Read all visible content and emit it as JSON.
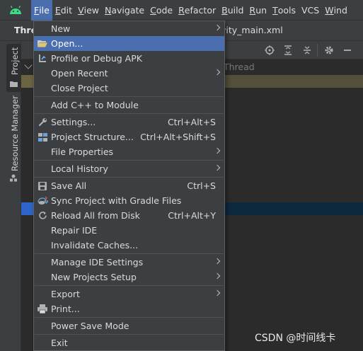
{
  "menubar": {
    "items": [
      {
        "label": "File",
        "mn": "F",
        "rest": "ile"
      },
      {
        "label": "Edit",
        "mn": "E",
        "rest": "dit"
      },
      {
        "label": "View",
        "mn": "V",
        "rest": "iew"
      },
      {
        "label": "Navigate",
        "mn": "N",
        "rest": "avigate"
      },
      {
        "label": "Code",
        "mn": "C",
        "rest": "ode"
      },
      {
        "label": "Refactor",
        "mn": "R",
        "rest": "efactor"
      },
      {
        "label": "Build",
        "mn": "B",
        "rest": "uild"
      },
      {
        "label": "Run",
        "mn": "R",
        "rest": "un"
      },
      {
        "label": "Tools",
        "mn": "T",
        "rest": "ools"
      },
      {
        "label": "VCS",
        "mn": "",
        "rest": "VCS"
      },
      {
        "label": "Wind",
        "mn": "W",
        "rest": "ind"
      }
    ]
  },
  "title_row": {
    "project_title": "Thre",
    "editor_tab": "vity_main.xml"
  },
  "tool_window": {
    "project_tab": "Project",
    "resource_manager_tab": "Resource Manager"
  },
  "editor": {
    "thread_text": "Thread"
  },
  "file_menu": {
    "items": [
      {
        "label": "New",
        "shortcut": "",
        "submenu": true,
        "icon": ""
      },
      {
        "label": "Open...",
        "shortcut": "",
        "submenu": false,
        "icon": "folder-open-icon",
        "selected": true
      },
      {
        "label": "Profile or Debug APK",
        "shortcut": "",
        "submenu": false,
        "icon": "profile-apk-icon"
      },
      {
        "label": "Open Recent",
        "shortcut": "",
        "submenu": true,
        "icon": ""
      },
      {
        "label": "Close Project",
        "shortcut": "",
        "submenu": false,
        "icon": ""
      },
      {
        "label": "Add C++ to Module",
        "shortcut": "",
        "submenu": false,
        "icon": ""
      },
      {
        "label": "Settings...",
        "shortcut": "Ctrl+Alt+S",
        "submenu": false,
        "icon": "wrench-icon"
      },
      {
        "label": "Project Structure...",
        "shortcut": "Ctrl+Alt+Shift+S",
        "submenu": false,
        "icon": "project-structure-icon"
      },
      {
        "label": "File Properties",
        "shortcut": "",
        "submenu": true,
        "icon": ""
      },
      {
        "label": "Local History",
        "shortcut": "",
        "submenu": true,
        "icon": ""
      },
      {
        "label": "Save All",
        "shortcut": "Ctrl+S",
        "submenu": false,
        "icon": "save-icon"
      },
      {
        "label": "Sync Project with Gradle Files",
        "shortcut": "",
        "submenu": false,
        "icon": "gradle-sync-icon"
      },
      {
        "label": "Reload All from Disk",
        "shortcut": "Ctrl+Alt+Y",
        "submenu": false,
        "icon": "reload-icon"
      },
      {
        "label": "Repair IDE",
        "shortcut": "",
        "submenu": false,
        "icon": ""
      },
      {
        "label": "Invalidate Caches...",
        "shortcut": "",
        "submenu": false,
        "icon": ""
      },
      {
        "label": "Manage IDE Settings",
        "shortcut": "",
        "submenu": true,
        "icon": ""
      },
      {
        "label": "New Projects Setup",
        "shortcut": "",
        "submenu": true,
        "icon": ""
      },
      {
        "label": "Export",
        "shortcut": "",
        "submenu": true,
        "icon": ""
      },
      {
        "label": "Print...",
        "shortcut": "",
        "submenu": false,
        "icon": "print-icon"
      },
      {
        "label": "Power Save Mode",
        "shortcut": "",
        "submenu": false,
        "icon": ""
      },
      {
        "label": "Exit",
        "shortcut": "",
        "submenu": false,
        "icon": ""
      }
    ]
  },
  "watermark": "CSDN @时间线卡",
  "colors": {
    "menubar_bg": "#3c3f41",
    "selection": "#4b6eaf",
    "editor_bg": "#2b2b2b",
    "android_green": "#3ddc84"
  }
}
